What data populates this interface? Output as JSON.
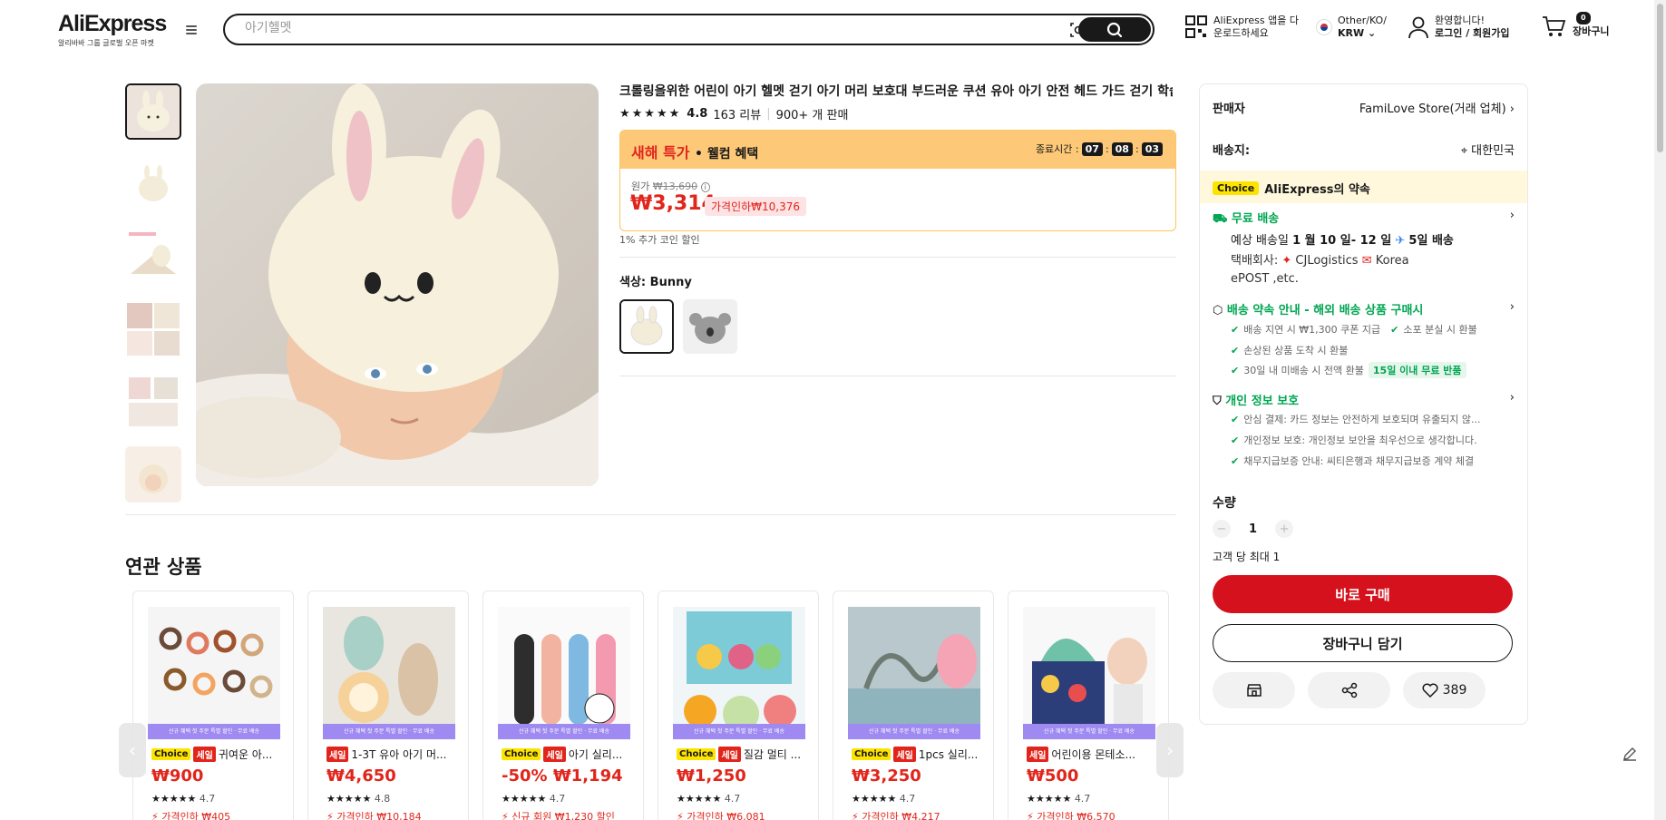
{
  "header": {
    "logo": "AliExpress",
    "logo_sub": "알리바바 그룹 글로벌 오픈 마켓",
    "search_placeholder": "아기헬멧",
    "app_line1": "AliExpress 앱을 다",
    "app_line2": "운로드하세요",
    "locale_line1": "Other/KO/",
    "locale_line2": "KRW",
    "account_line1": "환영합니다!",
    "account_line2": "로그인 / 회원가입",
    "cart_count": "0",
    "cart_label": "장바구니"
  },
  "product": {
    "title": "크롤링을위한 어린이 아기 헬멧 걷기 아기 머리 보호대 부드러운 쿠션 유아 아기 안전 헤드 가드 걷기 학습",
    "rating": "4.8",
    "reviews": "163 리뷰",
    "sold": "900+ 개 판매",
    "promo_title": "새해 특가",
    "promo_sub": "• 웰컴 혜택",
    "timer_label": "종료시간 :",
    "timer_h": "07",
    "timer_m": "08",
    "timer_s": "03",
    "orig_label": "원가",
    "orig_price": "₩13,690",
    "price": "₩3,314",
    "price_drop": "가격인하₩10,376",
    "coin": "1% 추가 코인 할인",
    "color_label": "색상:",
    "color_value": "Bunny"
  },
  "panel": {
    "seller_label": "판매자",
    "seller_value": "FamiLove Store(거래 업체)",
    "ship_to_label": "배송지:",
    "ship_to_value": "대한민국",
    "choice": "Choice",
    "promise": "AliExpress의 약속",
    "free_ship": "무료 배송",
    "delivery_prefix": "예상 배송일",
    "delivery_dates": "1 월 10 일- 12 일",
    "delivery_days": "5일 배송",
    "courier_label": "택배회사:",
    "courier1": "CJLogistics",
    "courier2": "Korea",
    "courier3": "ePOST ,etc.",
    "guarantee_title": "배송 약속 안내 - 해외 배송 상품 구매시",
    "g1": "배송 지연 시 ₩1,300 쿠폰 지급",
    "g2": "소포 분실 시 환불",
    "g3": "손상된 상품 도착 시 환불",
    "g4": "30일 내 미배송 시 전액 환불",
    "g4_tag": "15일 이내 무료 반품",
    "privacy_title": "개인 정보 보호",
    "p1": "안심 결제: 카드 정보는 안전하게 보호되며 유출되지 않...",
    "p2": "개인정보 보호: 개인정보 보안을 최우선으로 생각합니다.",
    "p3": "채무지급보증 안내: 씨티은행과 채무지급보증 계약 체결",
    "qty_label": "수량",
    "qty_value": "1",
    "qty_limit": "고객 당 최대 1",
    "buy_now": "바로 구매",
    "add_cart": "장바구니 담기",
    "wish_count": "389"
  },
  "related": {
    "title": "연관 상품",
    "banner": "신규 혜택 첫 주문 특별 할인 · 무료 배송",
    "items": [
      {
        "choice": "Choice",
        "sale": "세일",
        "name": "귀여운 아...",
        "price": "₩900",
        "rating": "4.7",
        "disc": "가격인하 ₩405"
      },
      {
        "choice": "",
        "sale": "세일",
        "name": "1-3T 유아 아기 머...",
        "price": "₩4,650",
        "rating": "4.8",
        "disc": "가격인하 ₩10,184"
      },
      {
        "choice": "Choice",
        "sale": "세일",
        "name": "아기 실리...",
        "price": "-50% ₩1,194",
        "rating": "4.7",
        "disc": "신규 회원 ₩1,230 할인"
      },
      {
        "choice": "Choice",
        "sale": "세일",
        "name": "질감 멀티 ...",
        "price": "₩1,250",
        "rating": "4.7",
        "disc": "가격인하 ₩6,081"
      },
      {
        "choice": "Choice",
        "sale": "세일",
        "name": "1pcs 실리...",
        "price": "₩3,250",
        "rating": "4.7",
        "disc": "가격인하 ₩4,217"
      },
      {
        "choice": "",
        "sale": "세일",
        "name": "어린이용 몬테소...",
        "price": "₩500",
        "rating": "4.7",
        "disc": "가격인하 ₩6,570"
      }
    ]
  }
}
